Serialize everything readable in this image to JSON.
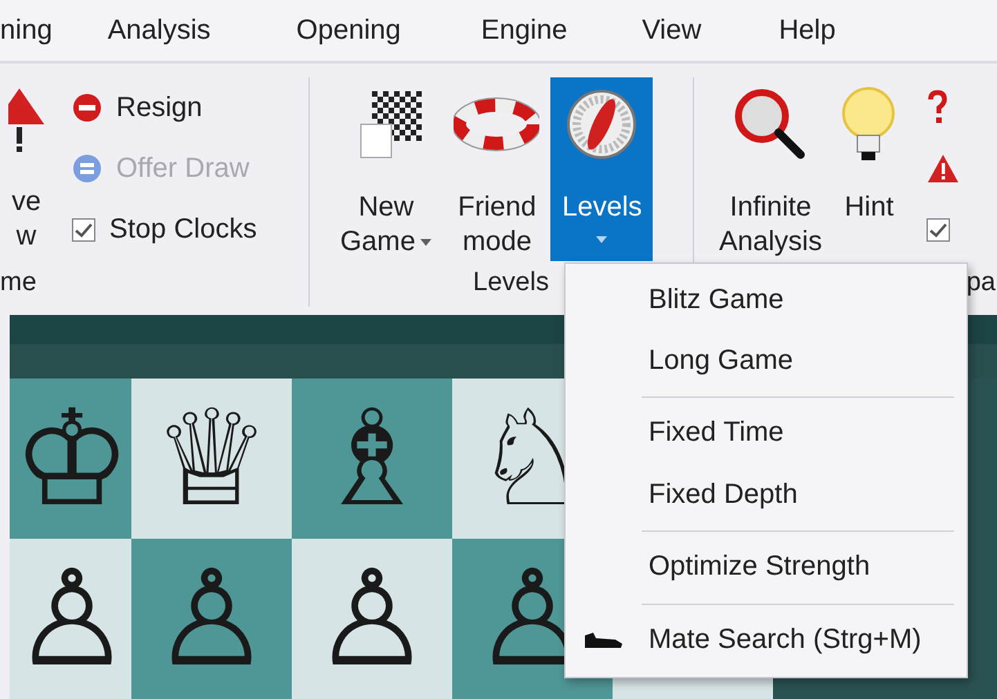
{
  "menu_bar": {
    "tabs": [
      {
        "label": "ning",
        "selected": false
      },
      {
        "label": "Analysis",
        "selected": false
      },
      {
        "label": "Opening",
        "selected": false
      },
      {
        "label": "Engine",
        "selected": false
      },
      {
        "label": "View",
        "selected": false
      },
      {
        "label": "Help",
        "selected": false
      }
    ]
  },
  "ribbon": {
    "groups": [
      {
        "label": "me",
        "items": [
          {
            "kind": "big",
            "lines": [
              "ve",
              "w"
            ],
            "dropdown": false,
            "selected": false
          },
          {
            "kind": "column",
            "items": [
              {
                "kind": "action",
                "label": "Resign",
                "disabled": false
              },
              {
                "kind": "action",
                "label": "Offer Draw",
                "disabled": true
              },
              {
                "kind": "check",
                "label": "Stop Clocks",
                "checked": true
              }
            ]
          }
        ]
      },
      {
        "label": "Levels",
        "items": [
          {
            "kind": "big",
            "lines": [
              "New",
              "Game"
            ],
            "dropdown": true,
            "selected": false
          },
          {
            "kind": "big",
            "lines": [
              "Friend",
              "mode"
            ],
            "dropdown": false,
            "selected": false
          },
          {
            "kind": "big",
            "lines": [
              "Levels"
            ],
            "dropdown": true,
            "selected": true
          }
        ]
      },
      {
        "label": "pa",
        "items": [
          {
            "kind": "big",
            "lines": [
              "Infinite",
              "Analysis"
            ],
            "dropdown": false,
            "selected": false
          },
          {
            "kind": "big",
            "lines": [
              "Hint"
            ],
            "dropdown": false,
            "selected": false
          },
          {
            "kind": "column",
            "items": [
              {
                "kind": "icon"
              },
              {
                "kind": "icon"
              },
              {
                "kind": "check",
                "checked": true
              }
            ]
          }
        ]
      }
    ]
  },
  "dropdown_menu": {
    "items": [
      {
        "kind": "plain",
        "label": "Blitz Game",
        "separator_before": false
      },
      {
        "kind": "plain",
        "label": "Long Game",
        "separator_before": false
      },
      {
        "kind": "plain",
        "label": "Fixed Time",
        "separator_before": true
      },
      {
        "kind": "plain",
        "label": "Fixed Depth",
        "separator_before": false
      },
      {
        "kind": "plain",
        "label": "Optimize Strength",
        "separator_before": true
      },
      {
        "kind": "with-icon",
        "label": "Mate Search (Strg+M)",
        "separator_before": true
      }
    ]
  },
  "board": {
    "rows": [
      [
        "♔",
        "♕",
        "♗",
        "♘"
      ],
      [
        "♙",
        "♙",
        "♙",
        "♙"
      ]
    ]
  }
}
